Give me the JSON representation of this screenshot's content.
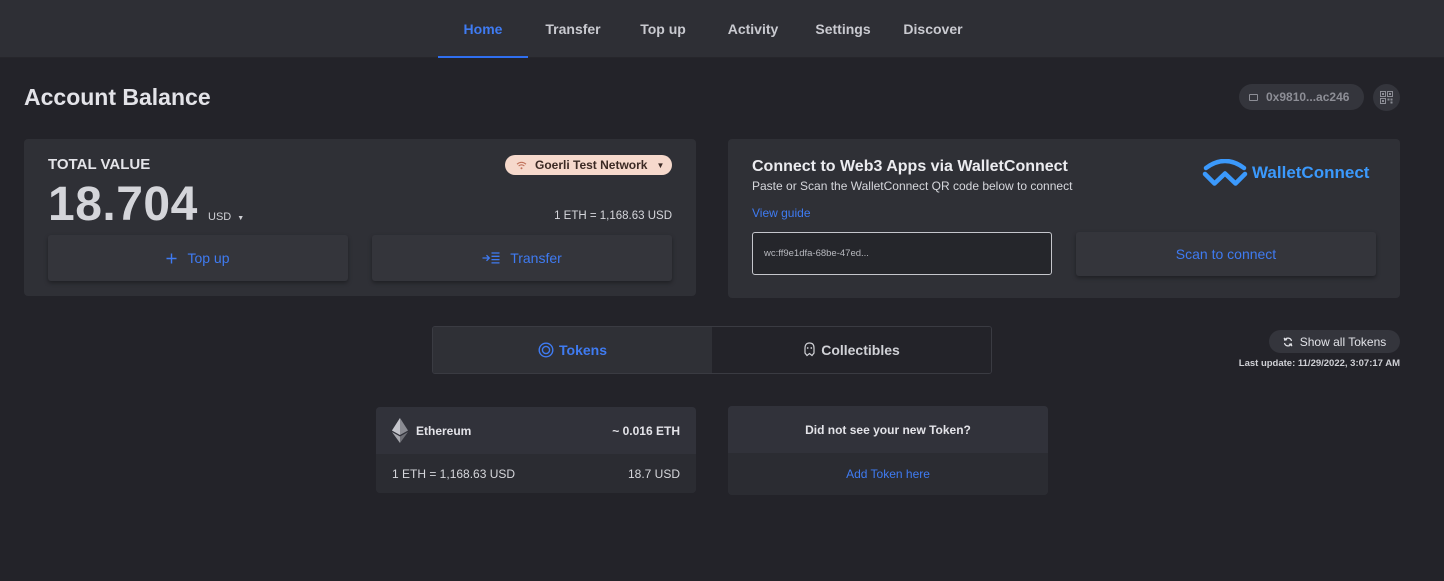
{
  "nav": {
    "tabs": [
      {
        "label": "Home"
      },
      {
        "label": "Transfer"
      },
      {
        "label": "Top up"
      },
      {
        "label": "Activity"
      },
      {
        "label": "Settings"
      },
      {
        "label": "Discover"
      }
    ],
    "active": "Home"
  },
  "header": {
    "title": "Account Balance",
    "address": "0x9810...ac246"
  },
  "balance": {
    "label": "TOTAL VALUE",
    "network": "Goerli Test Network",
    "value": "18.704",
    "currency": "USD",
    "rate": "1 ETH = 1,168.63 USD",
    "topup_label": "Top up",
    "transfer_label": "Transfer"
  },
  "walletconnect": {
    "title": "Connect to Web3 Apps via WalletConnect",
    "subtitle": "Paste or Scan the WalletConnect QR code below to connect",
    "guide_link": "View guide",
    "brand": "WalletConnect",
    "input_value": "wc:ff9e1dfa-68be-47ed...",
    "scan_label": "Scan to connect"
  },
  "assets": {
    "tabs": [
      {
        "label": "Tokens"
      },
      {
        "label": "Collectibles"
      }
    ],
    "active": "Tokens",
    "show_all_label": "Show all Tokens",
    "last_update": "Last update: 11/29/2022, 3:07:17 AM",
    "tokens": [
      {
        "name": "Ethereum",
        "amount": "~ 0.016 ETH",
        "rate": "1 ETH = 1,168.63 USD",
        "usd": "18.7 USD"
      }
    ],
    "add_token": {
      "question": "Did not see your new Token?",
      "link": "Add Token here"
    }
  },
  "colors": {
    "accent": "#3f7bf2",
    "background": "#232329",
    "card": "#2f3036",
    "network_pill": "#f6d9cc",
    "walletconnect_brand": "#3b99fc"
  }
}
